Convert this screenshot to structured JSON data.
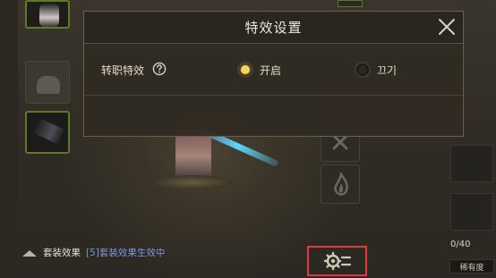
{
  "modal": {
    "title": "特效设置",
    "row": {
      "label": "转职特效",
      "options": [
        {
          "label": "开启",
          "selected": true
        },
        {
          "label": "끄기",
          "selected": false
        }
      ]
    }
  },
  "set_effect": {
    "title": "套装效果",
    "description": "[5]套装效果生效中"
  },
  "inventory": {
    "count": "0/40",
    "rarity_label": "稀有度"
  },
  "colors": {
    "accent": "#f6d35a",
    "highlight_box": "#e23a3a",
    "set_desc": "#7d9ad8"
  },
  "icons": {
    "close": "close-icon",
    "help": "question-circle-icon",
    "gear": "gear-icon",
    "collapse": "chevron-up-icon"
  }
}
